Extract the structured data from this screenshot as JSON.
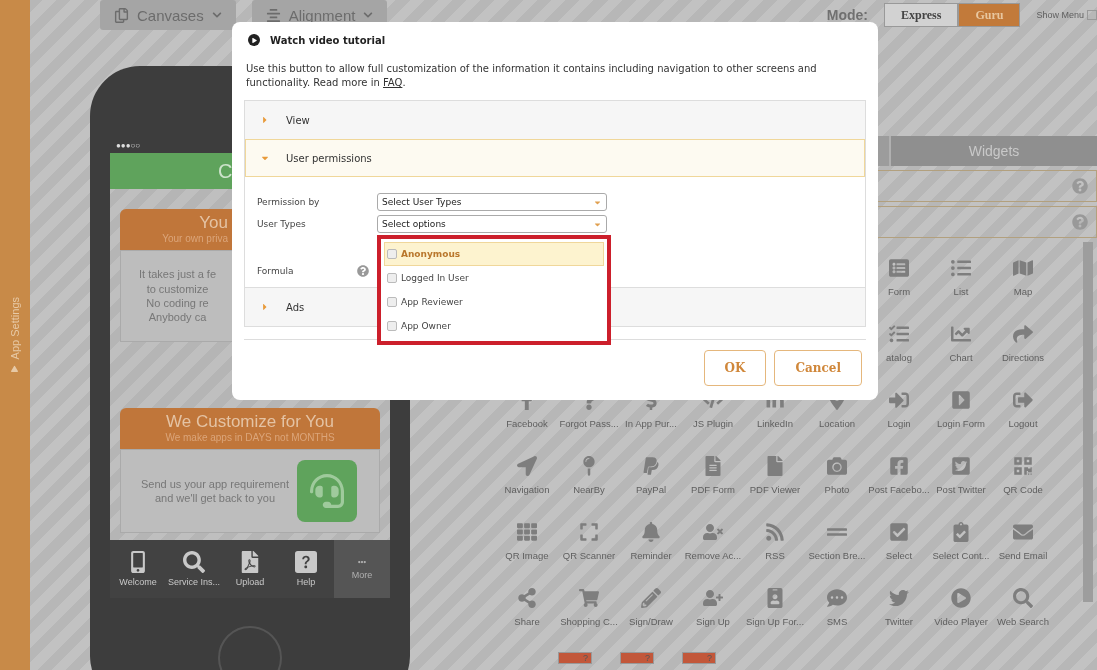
{
  "sidebar": {
    "label": "App Settings"
  },
  "toolbar": {
    "buttons": [
      {
        "label": "Canvases"
      },
      {
        "label": "Alignment"
      }
    ],
    "mode_label": "Mode:",
    "modes": [
      {
        "label": "Express",
        "selected": false
      },
      {
        "label": "Guru",
        "selected": true
      }
    ],
    "show_menu": {
      "label": "Show Menu",
      "checked": false
    }
  },
  "phone": {
    "status": "●●●○○",
    "header": "C",
    "cards": [
      {
        "title": "You",
        "subtitle": "Your own priva",
        "lines": [
          "It takes just a fe",
          "to customize",
          "No coding re",
          "Anybody ca"
        ]
      },
      {
        "title": "We Customize for You",
        "subtitle": "We make apps in DAYS not MONTHS",
        "lines": [
          "Send us your app requirement",
          "and we'll get back to you"
        ]
      }
    ],
    "tabs": [
      {
        "label": "Welcome",
        "selected": false
      },
      {
        "label": "Service Ins...",
        "selected": false
      },
      {
        "label": "Upload",
        "selected": false
      },
      {
        "label": "Help",
        "selected": false
      },
      {
        "label": "More",
        "selected": true
      }
    ]
  },
  "panel": {
    "tab": "Widgets",
    "widgets": [
      "Form",
      "List",
      "Map",
      "atalog",
      "Chart",
      "Directions",
      "Facebook",
      "Forgot Pass...",
      "In App Pur...",
      "JS Plugin",
      "LinkedIn",
      "Location",
      "Login",
      "Login Form",
      "Logout",
      "Navigation",
      "NearBy",
      "PayPal",
      "PDF Form",
      "PDF Viewer",
      "Photo",
      "Post Facebo...",
      "Post Twitter",
      "QR Code",
      "QR Image",
      "QR Scanner",
      "Reminder",
      "Remove Ac...",
      "RSS",
      "Section Bre...",
      "Select",
      "Select Cont...",
      "Send Email",
      "Share",
      "Shopping C...",
      "Sign/Draw",
      "Sign Up",
      "Sign Up For...",
      "SMS",
      "Twitter",
      "Video Player",
      "Web Search"
    ],
    "thumbnails": [
      "?",
      "?",
      "?"
    ]
  },
  "modal": {
    "video_link": "Watch video tutorial",
    "description": "Use this button to allow full customization of the information it contains including navigation to other screens and functionality. Read more in ",
    "link": "FAQ",
    "description_end": ".",
    "sections": [
      {
        "title": "View",
        "expanded": false
      },
      {
        "title": "User permissions",
        "expanded": true
      },
      {
        "title": "Ads",
        "expanded": false
      }
    ],
    "fields": [
      {
        "label": "Permission by",
        "value": "Select User Types"
      },
      {
        "label": "User Types",
        "value": "Select options"
      }
    ],
    "formula_label": "Formula",
    "options": [
      {
        "label": "Anonymous",
        "checked": false,
        "highlighted": true
      },
      {
        "label": "Logged In User",
        "checked": false,
        "highlighted": false
      },
      {
        "label": "App Reviewer",
        "checked": false,
        "highlighted": false
      },
      {
        "label": "App Owner",
        "checked": false,
        "highlighted": false
      }
    ],
    "buttons": [
      {
        "label": "OK"
      },
      {
        "label": "Cancel"
      }
    ]
  }
}
